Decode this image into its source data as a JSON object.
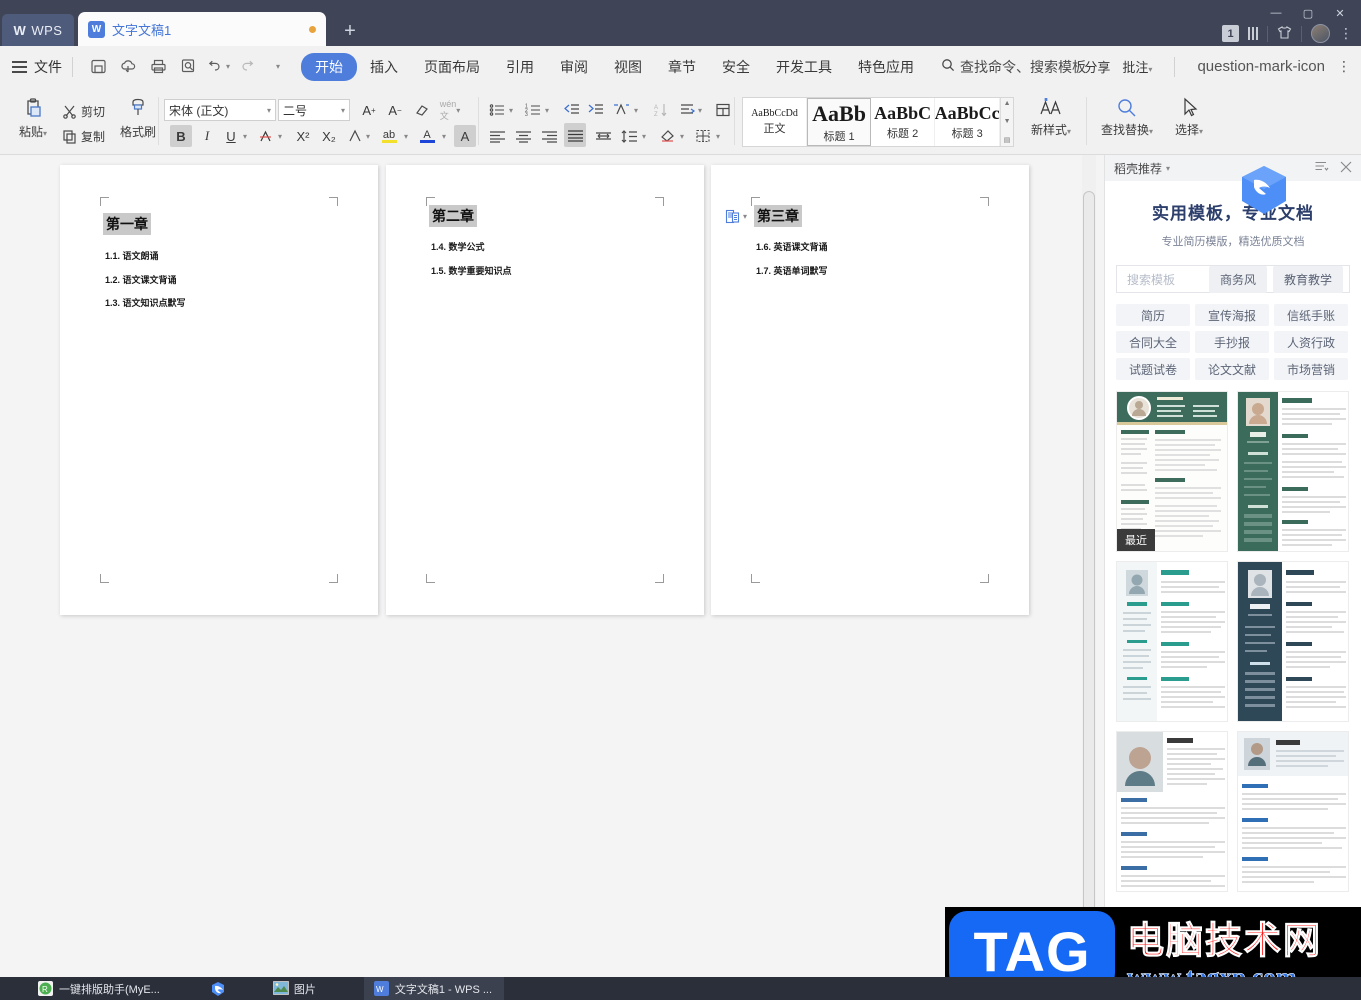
{
  "titlebar": {
    "app_badge": "WPS",
    "tab_title": "文字文稿1",
    "new_tab_icon": "plus-icon",
    "doc_icon_letter": "W",
    "notification_count": "1",
    "window_minimize": "—",
    "window_maximize": "▢",
    "window_close": "✕",
    "skin_icon": "tshirt-icon",
    "avatar_icon": "user-avatar",
    "more_icon": "vertical-dots-icon"
  },
  "menubar": {
    "hamburger_icon": "hamburger-icon",
    "file_label": "文件",
    "quick_icons": [
      "save-icon",
      "cloud-sync-icon",
      "print-icon",
      "print-preview-icon",
      "undo-icon",
      "redo-icon",
      "customize-icon"
    ],
    "start_tab": "开始",
    "items": [
      "插入",
      "页面布局",
      "引用",
      "审阅",
      "视图",
      "章节",
      "安全",
      "开发工具",
      "特色应用"
    ],
    "search_icon": "search-icon",
    "search_placeholder": "查找命令、搜索模板",
    "share_label": "分享",
    "comment_label": "批注",
    "help_icon": "question-mark-icon",
    "overflow_icon": "vertical-dots-icon"
  },
  "ribbon": {
    "paste_label": "粘贴",
    "cut_label": "剪切",
    "copy_label": "复制",
    "format_painter_label": "格式刷",
    "font_name": "宋体 (正文)",
    "font_size": "二号",
    "grow_font_icon": "increase-font-icon",
    "shrink_font_icon": "decrease-font-icon",
    "clear_format_icon": "clear-formatting-icon",
    "pinyin_icon": "pinyin-guide-icon",
    "bold_icon": "B",
    "italic_icon": "I",
    "underline_icon": "U",
    "strikethrough_icon": "A",
    "superscript_icon": "X²",
    "subscript_icon": "X₂",
    "char_border_icon": "character-border-icon",
    "highlight_icon": "text-highlight-icon",
    "font_color_icon": "font-color-icon",
    "char_shading_icon": "character-shading-icon",
    "bullet_list_icon": "bullet-list-icon",
    "number_list_icon": "numbered-list-icon",
    "decrease_indent_icon": "decrease-indent-icon",
    "increase_indent_icon": "increase-indent-icon",
    "sort_icon": "sort-icon",
    "show_marks_icon": "show-paragraph-marks-icon",
    "align_left_icon": "align-left-icon",
    "align_center_icon": "align-center-icon",
    "align_right_icon": "align-right-icon",
    "align_justify_icon": "align-justify-icon",
    "distribute_icon": "distributed-align-icon",
    "line_spacing_icon": "line-spacing-icon",
    "shading_icon": "paragraph-shading-icon",
    "para_layout_icon": "paragraph-layout-icon",
    "borders_icon": "borders-icon",
    "styles": [
      {
        "preview": "AaBbCcDd",
        "name": "正文",
        "size": "sm"
      },
      {
        "preview": "AaBb",
        "name": "标题 1",
        "size": "big"
      },
      {
        "preview": "AaBbC",
        "name": "标题 2",
        "size": "mid"
      },
      {
        "preview": "AaBbCc",
        "name": "标题 3",
        "size": "mid"
      }
    ],
    "new_style_label": "新样式",
    "new_style_icon": "new-style-icon",
    "find_replace_label": "查找替换",
    "find_replace_icon": "magnifier-icon",
    "select_label": "选择",
    "select_icon": "cursor-arrow-icon"
  },
  "document": {
    "pages": [
      {
        "heading": "第一章",
        "lines": [
          "1.1. 语文朗诵",
          "1.2. 语文课文背诵",
          "1.3. 语文知识点默写"
        ],
        "has_paste_icon": false
      },
      {
        "heading": "第二章",
        "lines": [
          "1.4. 数学公式",
          "1.5. 数学重要知识点"
        ],
        "has_paste_icon": false
      },
      {
        "heading": "第三章",
        "lines": [
          "1.6. 英语课文背诵",
          "1.7. 英语单词默写"
        ],
        "has_paste_icon": true,
        "paste_icon_name": "paste-options-icon"
      }
    ],
    "scrollbar_icon": "vertical-scrollbar"
  },
  "right_panel": {
    "header_title": "稻壳推荐",
    "header_caret": "chevron-down-icon",
    "list_icon": "list-options-icon",
    "close_icon": "close-icon",
    "title": "实用模板，专业文档",
    "subtitle": "专业简历模版，精选优质文档",
    "search_placeholder": "搜索模板",
    "search_pills": [
      "商务风",
      "教育教学"
    ],
    "chips": [
      "简历",
      "宣传海报",
      "信纸手账",
      "合同大全",
      "手抄报",
      "人资行政",
      "试题试卷",
      "论文文献",
      "市场营销"
    ],
    "recent_badge": "最近",
    "thumbnail_count": 6
  },
  "watermark": {
    "logo_text": "TAG",
    "site_name_cn": "电脑技术网",
    "site_url": "www.tagxp.com"
  },
  "taskbar": {
    "items": [
      {
        "label": "一键排版助手(MyE...",
        "icon": "app-icon-green",
        "active": false
      },
      {
        "label": "",
        "icon": "wps-cloud-icon",
        "active": false
      },
      {
        "label": "图片",
        "icon": "picture-icon",
        "active": false
      },
      {
        "label": "文字文稿1 - WPS ...",
        "icon": "wps-writer-icon",
        "active": true
      }
    ]
  },
  "colors": {
    "accent": "#4e7ddc",
    "titlebar_bg": "#3f4556",
    "ribbon_bg": "#f1f1f1",
    "panel_title": "#2c3e6b",
    "watermark_red": "#ff1111"
  }
}
